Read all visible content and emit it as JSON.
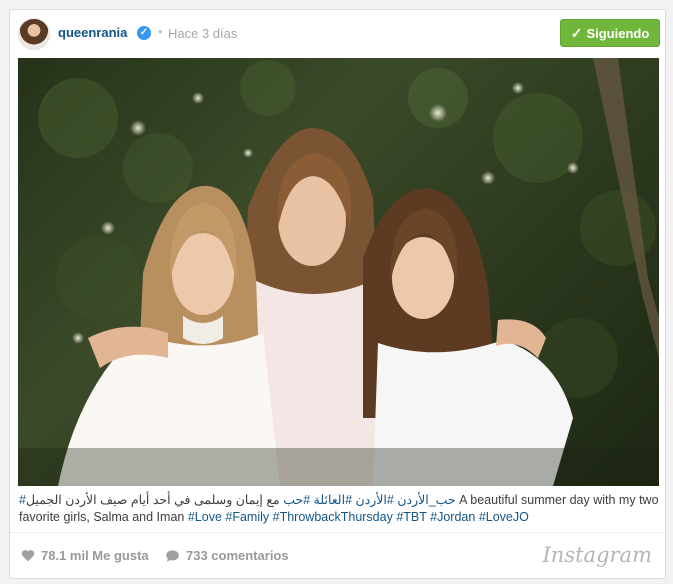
{
  "post": {
    "username": "queenrania",
    "verified_icon": "verified-badge-icon",
    "separator": "•",
    "time": "Hace 3 días",
    "follow_button": "Siguiendo",
    "follow_icon": "checkmark-icon"
  },
  "caption": {
    "arabic_part1": "#حب_الأردن #الأردن #العائلة #حب",
    "arabic_part2": "مع إيمان وسلمى في أحد أيام صيف الأردن الجميل",
    "english": "A beautiful summer day with my two favorite girls, Salma and Iman",
    "hashtags": [
      "#Love",
      "#Family",
      "#ThrowbackThursday",
      "#TBT",
      "#Jordan",
      "#LoveJO"
    ]
  },
  "stats": {
    "likes": "78.1 mil Me gusta",
    "comments": "733 comentarios",
    "like_icon": "heart-icon",
    "comment_icon": "speech-bubble-icon"
  },
  "brand": "Instagram",
  "colors": {
    "username": "#125688",
    "follow_button": "#70b63b",
    "verified": "#3897f0",
    "hashtag": "#125688"
  }
}
